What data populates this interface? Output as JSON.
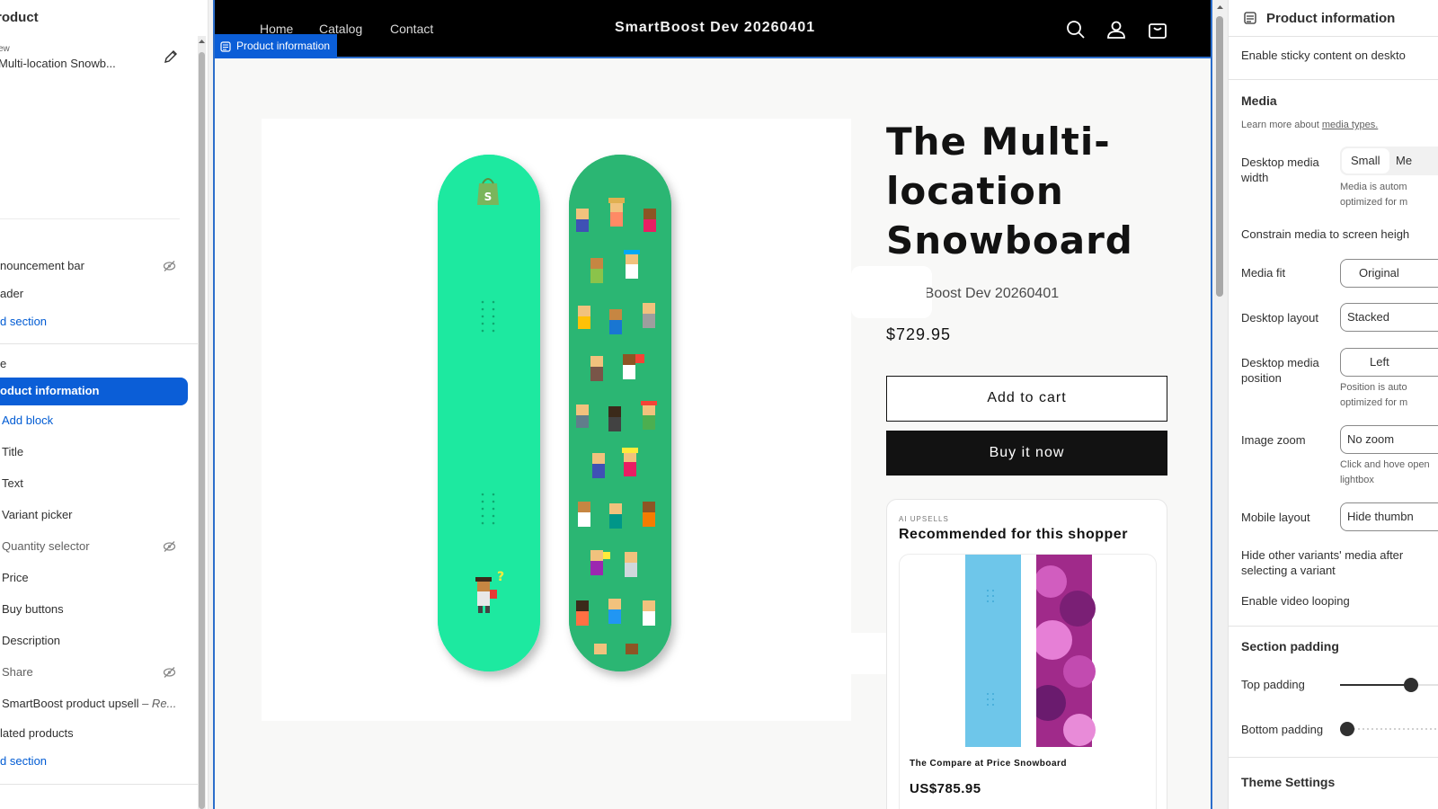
{
  "left_panel": {
    "title": "roduct",
    "preview_label": "ew",
    "preview_value": "Multi-location Snowb...",
    "header_group": [
      {
        "label": "nouncement bar",
        "hidden": true
      },
      {
        "label": "ader",
        "hidden": false
      }
    ],
    "add_section_1": "d section",
    "template_label": "e",
    "selected_section": "oduct information",
    "add_block": "Add block",
    "blocks": [
      {
        "label": "Title",
        "hidden": false
      },
      {
        "label": "Text",
        "hidden": false
      },
      {
        "label": "Variant picker",
        "hidden": false
      },
      {
        "label": "Quantity selector",
        "hidden": true
      },
      {
        "label": "Price",
        "hidden": false
      },
      {
        "label": "Buy buttons",
        "hidden": false
      },
      {
        "label": "Description",
        "hidden": false
      },
      {
        "label": "Share",
        "hidden": true
      },
      {
        "label": "SmartBoost product upsell",
        "suffix": "– Re...",
        "hidden": false
      }
    ],
    "related_products": "lated products",
    "add_section_2": "d section"
  },
  "preview": {
    "nav": [
      "Home",
      "Catalog",
      "Contact"
    ],
    "store_name": "SmartBoost Dev 20260401",
    "section_tag": "Product information",
    "icons": [
      "search-icon",
      "account-icon",
      "cart-icon"
    ],
    "product": {
      "title": "The Multi-location Snowboard",
      "vendor": "SmartBoost Dev 20260401",
      "price": "$729.95",
      "add_to_cart": "Add to cart",
      "buy_now": "Buy it now"
    },
    "upsell": {
      "eyebrow": "AI UPSELLS",
      "heading": "Recommended for this shopper",
      "product_name": "The Compare at Price Snowboard",
      "product_price": "US$785.95"
    }
  },
  "right_panel": {
    "title": "Product information",
    "sticky": "Enable sticky content on deskto",
    "media_heading": "Media",
    "media_help_prefix": "Learn more about ",
    "media_help_link": "media types.",
    "desktop_media_width_label": "Desktop media width",
    "desktop_media_width_options": [
      "Small",
      "Me"
    ],
    "desktop_media_width_help": "Media is autom optimized for m",
    "constrain": "Constrain media to screen heigh",
    "media_fit_label": "Media fit",
    "media_fit_value": "Original",
    "desktop_layout_label": "Desktop layout",
    "desktop_layout_value": "Stacked",
    "desktop_media_position_label": "Desktop media position",
    "desktop_media_position_value": "Left",
    "desktop_media_position_help": "Position is auto optimized for m",
    "image_zoom_label": "Image zoom",
    "image_zoom_value": "No zoom",
    "image_zoom_help": "Click and hove open lightbox",
    "mobile_layout_label": "Mobile layout",
    "mobile_layout_value": "Hide thumbn",
    "hide_variants": "Hide other variants' media after selecting a variant",
    "video_looping": "Enable video looping",
    "section_padding_heading": "Section padding",
    "top_padding_label": "Top padding",
    "top_padding_value": 0.75,
    "bottom_padding_label": "Bottom padding",
    "bottom_padding_value": 0.0,
    "theme_settings": "Theme Settings"
  },
  "colors": {
    "accent": "#0b5ed7",
    "board_mint": "#1de9a0",
    "board_green": "#2bb673"
  }
}
